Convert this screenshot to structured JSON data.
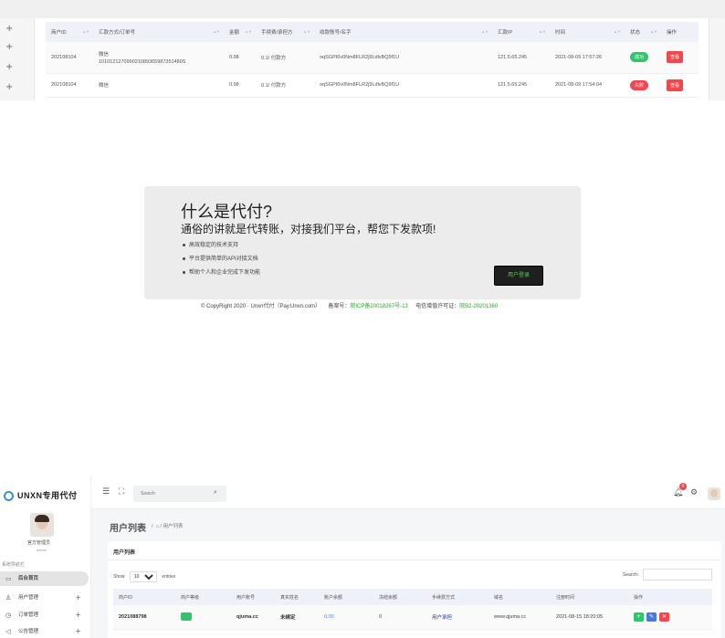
{
  "top_table": {
    "headers": [
      "商户ID",
      "汇款方式/订单号",
      "金额",
      "手续费/承担方",
      "收款账号/名字",
      "汇款IP",
      "时间",
      "状态",
      "操作"
    ],
    "rows": [
      {
        "id": "202108104",
        "method": "微信",
        "order": "101012127099021089365987351480S",
        "amount": "0.98",
        "fee": "0.1/ 付款方",
        "account": "oqSGPI6v0Nm8FLR2j9LdlvBQ9f1U",
        "ip": "121.5.65.245",
        "time": "2021-08-09 17:57:26",
        "status": "成功",
        "action": "查看"
      },
      {
        "id": "202108104",
        "method": "微信",
        "order": "",
        "amount": "0.98",
        "fee": "0.1/ 付款方",
        "account": "oqSGPI6v0Nm8FLR2j9LdlvBQ9f1U",
        "ip": "121.5.65.245",
        "time": "2021-08-09 17:54:04",
        "status": "失败",
        "action": "查看"
      }
    ]
  },
  "info_box": {
    "title": "什么是代付?",
    "subtitle": "通俗的讲就是代转账，对接我们平台，帮您下发款项!",
    "bullets": [
      "高效稳定的技术支持",
      "平台提供简单的API对接文档",
      "帮助个人和企业完成下发功能"
    ],
    "login_button": "用户登录"
  },
  "footer": {
    "copyright": "© CopyRight 2020 · Unxn代付（Pay.Unxn.com）",
    "beian_label": "备案号：",
    "beian": "皖ICP备20018267号-13",
    "license_label": "电信增值许可证：",
    "license": "皖B2-20201360"
  },
  "admin": {
    "logo": "UNXN专用代付",
    "user_name": "官方管理员",
    "user_role": "admin",
    "nav_category": "系统导航栏",
    "nav": [
      {
        "label": "后台首页",
        "icon": "▭",
        "active": true
      },
      {
        "label": "用户管理",
        "icon": "♙"
      },
      {
        "label": "订单管理",
        "icon": "◷"
      },
      {
        "label": "公告管理",
        "icon": "◁"
      }
    ],
    "search_placeholder": "Search",
    "notification_count": "0",
    "page_title": "用户列表",
    "breadcrumb_sep": "/",
    "breadcrumb_home": "⌂",
    "breadcrumb_current": "用户列表",
    "card_title": "用户列表",
    "show_label": "Show",
    "entries_value": "10",
    "entries_label": "entries",
    "search_label": "Search:",
    "table_headers": [
      "商户ID",
      "商户等级",
      "用户账号",
      "真实姓名",
      "账户余额",
      "冻结余额",
      "手续费方式",
      "域名",
      "注册时间",
      "操作"
    ],
    "table_row": {
      "id": "2021088798",
      "account": "qjuma.cc",
      "real_name": "未绑定",
      "balance": "0.00",
      "frozen": "0",
      "fee_mode": "用户承担",
      "domain": "www.qjuma.cc",
      "reg_time": "2021-08-15 18:20:05"
    }
  }
}
